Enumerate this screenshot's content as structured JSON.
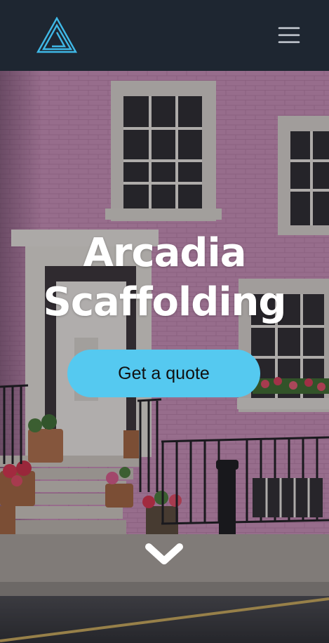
{
  "header": {
    "logo_icon": "arcadia-triangle-logo-icon",
    "menu_icon": "hamburger-menu-icon",
    "accent_color": "#3fb8e6",
    "background_color": "#1e2631"
  },
  "hero": {
    "title_line1": "Arcadia",
    "title_line2": "Scaffolding",
    "cta_label": "Get a quote",
    "cta_color": "#55c9f0",
    "scroll_icon": "chevron-down-icon",
    "background_image": "pink-townhouse-street-photo"
  }
}
